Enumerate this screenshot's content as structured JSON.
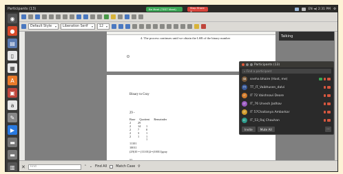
{
  "window": {
    "title": "Participants (13)"
  },
  "meet": {
    "tab_label": "Be Meet (TEST Meet)",
    "stop_label": "Stop Share ✕"
  },
  "tray": {
    "status": "EN ◄) 2:31 PM"
  },
  "toolbar2": {
    "style": "Default Style",
    "font": "Liberation Serif",
    "size": "12"
  },
  "document": {
    "step4": "4.  The process continues until we obtain the LSB of the binary number",
    "heading": "Binary to Gray",
    "number": "29 -",
    "table_headers": [
      "Base",
      "Quotient",
      "Remainder"
    ],
    "table_rows": [
      [
        "2",
        "29",
        ""
      ],
      [
        "2",
        "14",
        "1"
      ],
      [
        "2",
        "7",
        "0"
      ],
      [
        "2",
        "3",
        "1"
      ],
      [
        "2",
        "1",
        "1"
      ],
      [
        "",
        "",
        "1"
      ]
    ],
    "bin1": "11101",
    "bin2": "10011",
    "bin_eq": "(29)10 = (11101)2=(10011)gray",
    "last": "52"
  },
  "talking": {
    "label": "Talking"
  },
  "participants": {
    "header": "Participants (13)",
    "search_placeholder": "Find a participant",
    "list": [
      {
        "name": "sneha bhaire (Host, me)",
        "initials": "SB",
        "color": "#7a5a3a"
      },
      {
        "name": "TT_IT_Vaibhusen_dalvi",
        "initials": "TT",
        "color": "#3a5a9a"
      },
      {
        "name": "IT 72 Vaishnavi Deore",
        "initials": "IT",
        "color": "#d07a2a"
      },
      {
        "name": "IT_76 Urvesh Jadhav",
        "initials": "IT",
        "color": "#9a5ac0"
      },
      {
        "name": "IT 57Chaitanya Ambarkar",
        "initials": "IT",
        "color": "#d09a2a"
      },
      {
        "name": "IT_53_Raj Chauhan",
        "initials": "IC",
        "color": "#2a9a8a"
      }
    ],
    "invite_label": "Invite",
    "mute_label": "Mute All",
    "more_label": "..."
  },
  "findbar": {
    "placeholder": "Find",
    "find_all": "Find All",
    "match_case": "Match Case"
  }
}
